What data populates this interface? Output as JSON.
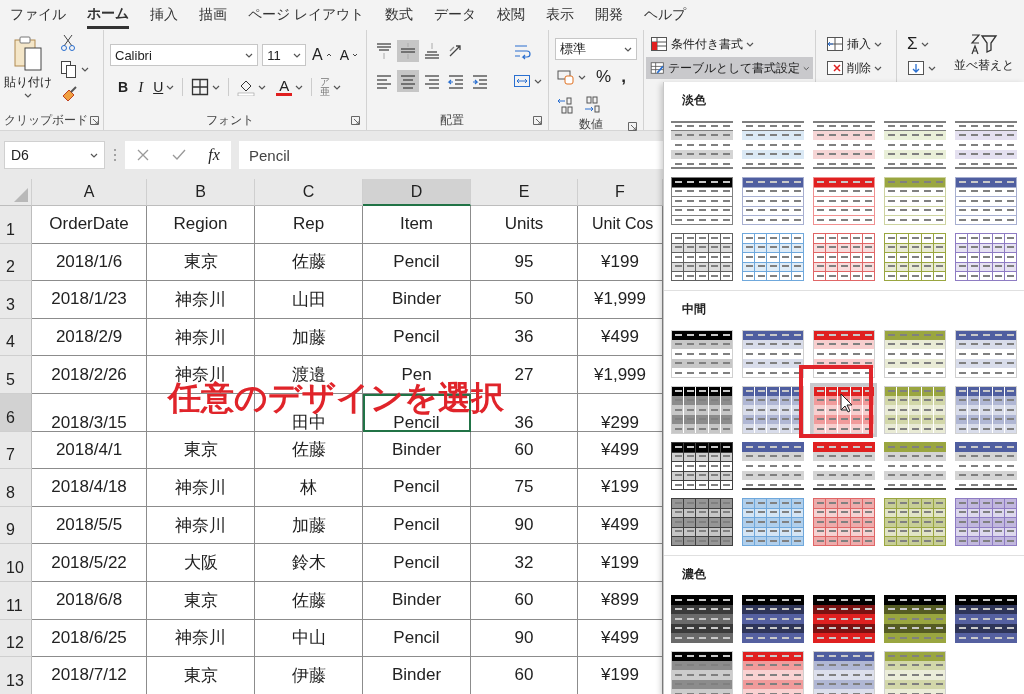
{
  "tabs": [
    {
      "label": "ファイル",
      "selected": false
    },
    {
      "label": "ホーム",
      "selected": true
    },
    {
      "label": "挿入",
      "selected": false
    },
    {
      "label": "描画",
      "selected": false
    },
    {
      "label": "ページ レイアウト",
      "selected": false
    },
    {
      "label": "数式",
      "selected": false
    },
    {
      "label": "データ",
      "selected": false
    },
    {
      "label": "校閲",
      "selected": false
    },
    {
      "label": "表示",
      "selected": false
    },
    {
      "label": "開発",
      "selected": false
    },
    {
      "label": "ヘルプ",
      "selected": false
    }
  ],
  "ribbon": {
    "clipboard": {
      "paste": "貼り付け",
      "label": "クリップボード"
    },
    "font": {
      "name": "Calibri",
      "size": "11",
      "grow": "A",
      "shrink": "A",
      "bold": "B",
      "italic": "I",
      "underline": "U",
      "font_color": "A",
      "phonetic": "ア亜",
      "label": "フォント"
    },
    "alignment": {
      "top_row": [
        {
          "kind": "align-top",
          "selected": false
        },
        {
          "kind": "align-middle",
          "selected": true
        },
        {
          "kind": "align-bottom",
          "selected": false
        },
        {
          "kind": "orientation",
          "selected": false
        }
      ],
      "bottom_row": [
        {
          "kind": "align-left",
          "selected": false
        },
        {
          "kind": "align-center",
          "selected": true
        },
        {
          "kind": "align-right",
          "selected": false
        },
        {
          "kind": "indent-decrease",
          "selected": false
        },
        {
          "kind": "indent-increase",
          "selected": false
        }
      ],
      "label": "配置"
    },
    "number": {
      "format": "標準",
      "percent": "%",
      "comma": ",",
      "label": "数値"
    },
    "styles": {
      "conditional": "条件付き書式",
      "format_as_table": "テーブルとして書式設定",
      "format_as_table_expanded": true
    },
    "cells": {
      "insert": "挿入",
      "delete": "削除"
    },
    "editing": {
      "sum": "Σ",
      "sort": "並べ替えと"
    }
  },
  "formula_bar": {
    "name_box": "D6",
    "fx": "fx",
    "value": "Pencil"
  },
  "sheet": {
    "columns": [
      {
        "label": "A",
        "selected": false
      },
      {
        "label": "B",
        "selected": false
      },
      {
        "label": "C",
        "selected": false
      },
      {
        "label": "D",
        "selected": true
      },
      {
        "label": "E",
        "selected": false
      },
      {
        "label": "F",
        "selected": false
      }
    ],
    "rows": [
      {
        "number": "1",
        "selected": false,
        "cells": [
          "OrderDate",
          "Region",
          "Rep",
          "Item",
          "Units",
          "Unit Cos"
        ]
      },
      {
        "number": "2",
        "selected": false,
        "cells": [
          "2018/1/6",
          "東京",
          "佐藤",
          "Pencil",
          "95",
          "¥199"
        ]
      },
      {
        "number": "3",
        "selected": false,
        "cells": [
          "2018/1/23",
          "神奈川",
          "山田",
          "Binder",
          "50",
          "¥1,999"
        ]
      },
      {
        "number": "4",
        "selected": false,
        "cells": [
          "2018/2/9",
          "神奈川",
          "加藤",
          "Pencil",
          "36",
          "¥499"
        ]
      },
      {
        "number": "5",
        "selected": false,
        "cells": [
          "2018/2/26",
          "神奈川",
          "渡邉",
          "Pen",
          "27",
          "¥1,999"
        ]
      },
      {
        "number": "6",
        "selected": true,
        "cells": [
          "2018/3/15",
          null,
          "田中",
          "Pencil",
          "36",
          "¥299"
        ]
      },
      {
        "number": "7",
        "selected": false,
        "cells": [
          "2018/4/1",
          "東京",
          "佐藤",
          "Binder",
          "60",
          "¥499"
        ]
      },
      {
        "number": "8",
        "selected": false,
        "cells": [
          "2018/4/18",
          "神奈川",
          "林",
          "Pencil",
          "75",
          "¥199"
        ]
      },
      {
        "number": "9",
        "selected": false,
        "cells": [
          "2018/5/5",
          "神奈川",
          "加藤",
          "Pencil",
          "90",
          "¥499"
        ]
      },
      {
        "number": "10",
        "selected": false,
        "cells": [
          "2018/5/22",
          "大阪",
          "鈴木",
          "Pencil",
          "32",
          "¥199"
        ]
      },
      {
        "number": "11",
        "selected": false,
        "cells": [
          "2018/6/8",
          "東京",
          "佐藤",
          "Binder",
          "60",
          "¥899"
        ]
      },
      {
        "number": "12",
        "selected": false,
        "cells": [
          "2018/6/25",
          "神奈川",
          "中山",
          "Pencil",
          "90",
          "¥499"
        ]
      },
      {
        "number": "13",
        "selected": false,
        "cells": [
          "2018/7/12",
          "東京",
          "伊藤",
          "Binder",
          "60",
          "¥199"
        ]
      }
    ]
  },
  "annotation": {
    "text": "任意のデザインを選択"
  },
  "gallery": {
    "sections": [
      {
        "title": "淡色",
        "styles": [
          {
            "kind": "lines",
            "color": "#d4d4d4",
            "selected": false
          },
          {
            "kind": "lines",
            "color": "#dbe9f5",
            "selected": false
          },
          {
            "kind": "lines",
            "color": "#f6d5d5",
            "selected": false
          },
          {
            "kind": "lines",
            "color": "#e9efd8",
            "selected": false
          },
          {
            "kind": "lines",
            "color": "#e4e0f0",
            "selected": false
          },
          {
            "kind": "header",
            "color": "#000000",
            "selected": false
          },
          {
            "kind": "header",
            "color": "#4f5ea0",
            "selected": false
          },
          {
            "kind": "header",
            "color": "#e02020",
            "selected": false
          },
          {
            "kind": "header",
            "color": "#9aa640",
            "selected": false
          },
          {
            "kind": "header",
            "color": "#4f5ea0",
            "selected": false
          },
          {
            "kind": "grid",
            "color": "#606060",
            "selected": false
          },
          {
            "kind": "grid",
            "color": "#6fa8dc",
            "selected": false
          },
          {
            "kind": "grid",
            "color": "#e06666",
            "selected": false
          },
          {
            "kind": "grid",
            "color": "#9aa640",
            "selected": false
          },
          {
            "kind": "grid",
            "color": "#8e7cc3",
            "selected": false
          }
        ]
      },
      {
        "title": "中間",
        "styles": [
          {
            "kind": "banded",
            "color": "#000000",
            "selected": false
          },
          {
            "kind": "banded",
            "color": "#4f5ea0",
            "selected": false
          },
          {
            "kind": "banded",
            "color": "#e02020",
            "selected": false
          },
          {
            "kind": "banded",
            "color": "#9aa640",
            "selected": false
          },
          {
            "kind": "banded",
            "color": "#4f5ea0",
            "selected": false
          },
          {
            "kind": "grid-banded",
            "color": "#000000",
            "selected": false
          },
          {
            "kind": "grid-banded",
            "color": "#4f5ea0",
            "selected": false
          },
          {
            "kind": "grid-banded",
            "color": "#e02020",
            "selected": true
          },
          {
            "kind": "grid-banded",
            "color": "#9aa640",
            "selected": false
          },
          {
            "kind": "grid-banded",
            "color": "#4f5ea0",
            "selected": false
          },
          {
            "kind": "header-grid",
            "color": "#000000",
            "selected": false
          },
          {
            "kind": "header-lines",
            "color": "#4f5ea0",
            "selected": false
          },
          {
            "kind": "header-lines",
            "color": "#e02020",
            "selected": false
          },
          {
            "kind": "header-lines",
            "color": "#9aa640",
            "selected": false
          },
          {
            "kind": "header-lines",
            "color": "#4f5ea0",
            "selected": false
          },
          {
            "kind": "grid-strong",
            "color": "#404040",
            "selected": false
          },
          {
            "kind": "grid-strong",
            "color": "#6fa8dc",
            "selected": false
          },
          {
            "kind": "grid-strong",
            "color": "#e06666",
            "selected": false
          },
          {
            "kind": "grid-strong",
            "color": "#9aa640",
            "selected": false
          },
          {
            "kind": "grid-strong",
            "color": "#8e7cc3",
            "selected": false
          }
        ]
      },
      {
        "title": "濃色",
        "styles": [
          {
            "kind": "dark",
            "color": "#6a6a6a",
            "selected": false
          },
          {
            "kind": "dark",
            "color": "#5560a0",
            "selected": false
          },
          {
            "kind": "dark",
            "color": "#e02020",
            "selected": false
          },
          {
            "kind": "dark",
            "color": "#9aa640",
            "selected": false
          },
          {
            "kind": "dark",
            "color": "#5560a0",
            "selected": false
          },
          {
            "kind": "dark-banded",
            "color": "#000000",
            "selected": false
          },
          {
            "kind": "dark-banded",
            "color": "#e02020",
            "selected": false
          },
          {
            "kind": "dark-banded",
            "color": "#4f5ea0",
            "selected": false
          },
          {
            "kind": "dark-banded",
            "color": "#9aa640",
            "selected": false
          }
        ]
      }
    ]
  }
}
